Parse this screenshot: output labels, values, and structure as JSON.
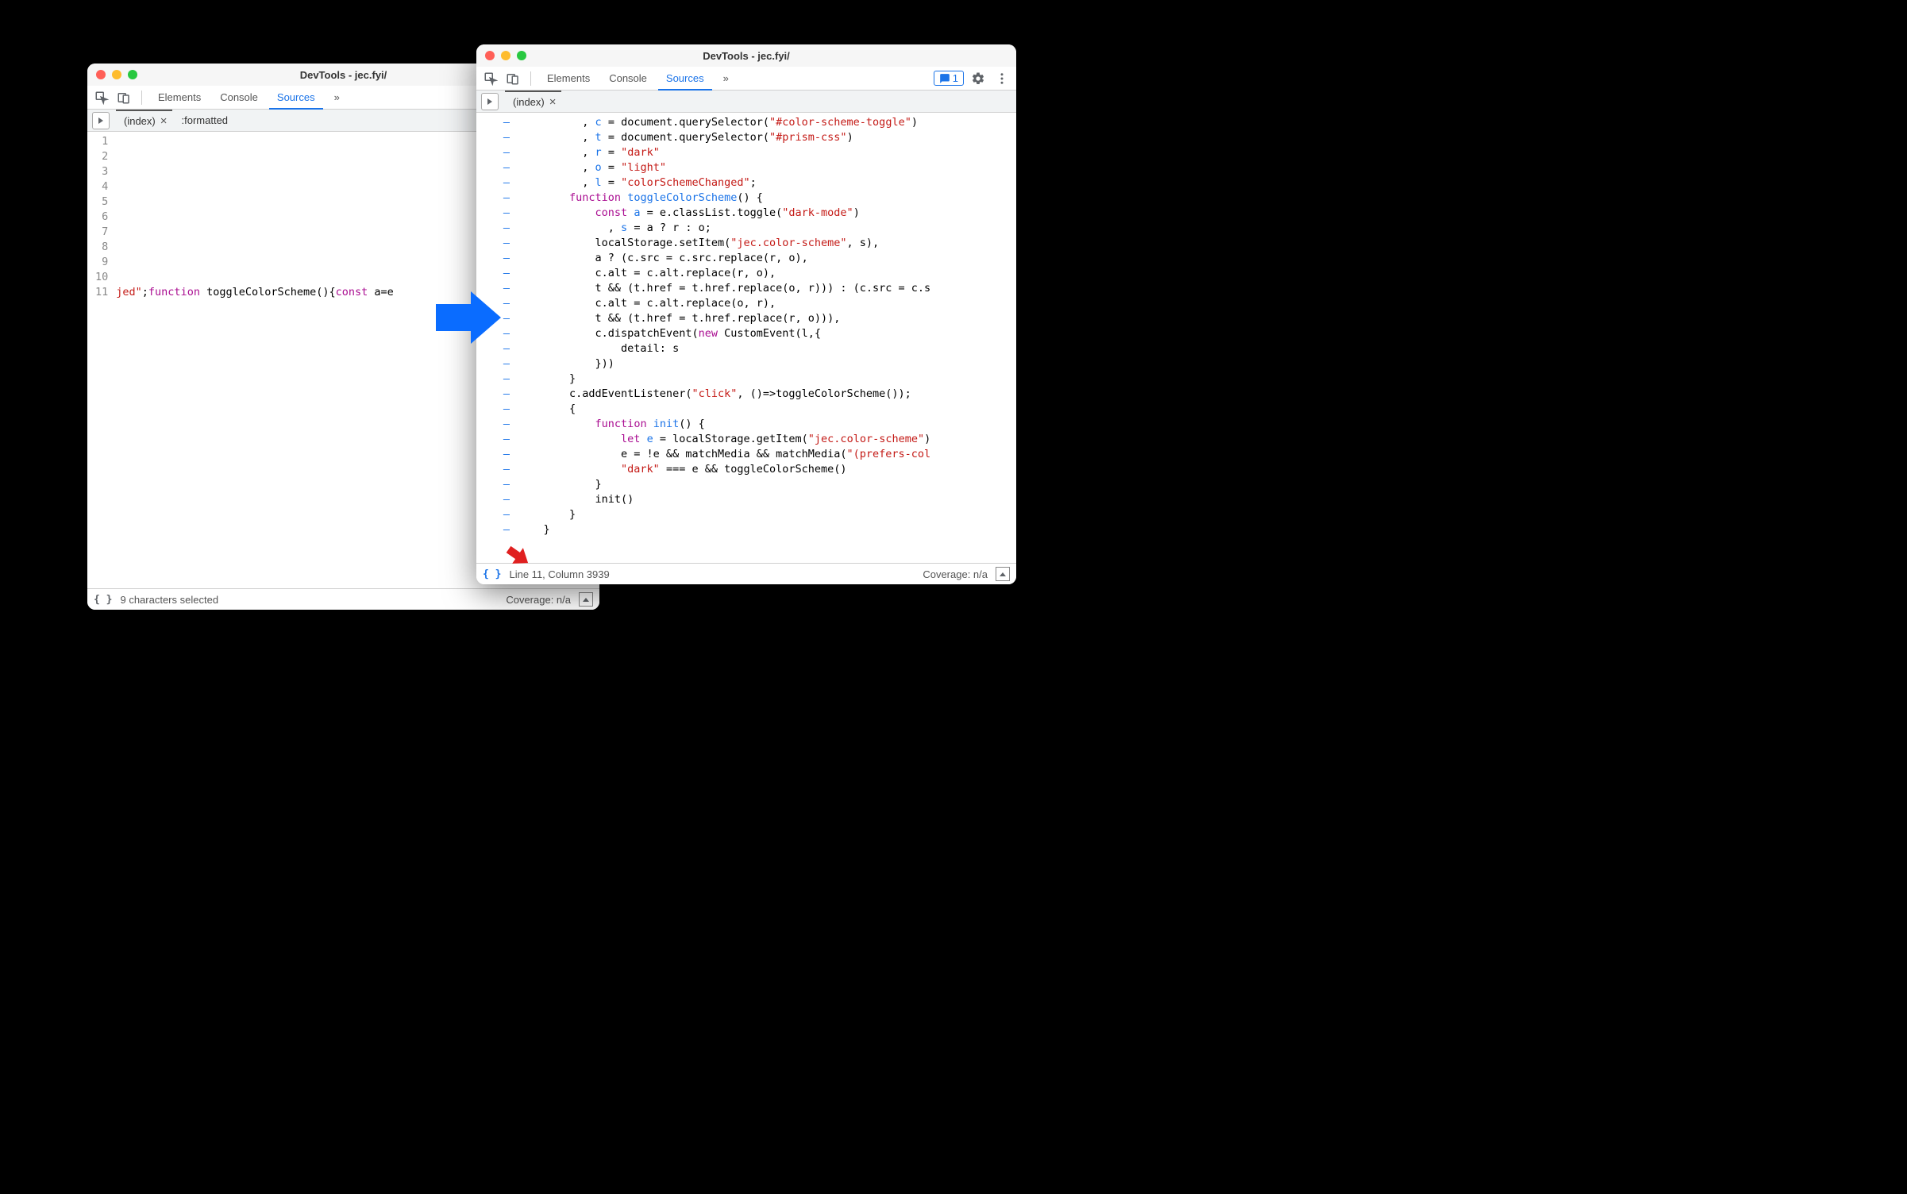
{
  "left": {
    "title": "DevTools - jec.fyi/",
    "tabs": [
      "Elements",
      "Console",
      "Sources"
    ],
    "active_tab": "Sources",
    "more": "»",
    "filetabs": {
      "index": "(index)",
      "formatted": ":formatted"
    },
    "line_numbers": [
      "1",
      "2",
      "3",
      "4",
      "5",
      "6",
      "7",
      "8",
      "9",
      "10",
      "11"
    ],
    "code": {
      "frag1": "jed\"",
      "frag2": ";",
      "kw_function": "function",
      "fn_name": " toggleColorScheme(){",
      "kw_const": "const",
      "frag3": " a=e"
    },
    "status": {
      "pp": "{ }",
      "selection": "9 characters selected",
      "coverage": "Coverage: n/a"
    }
  },
  "right": {
    "title": "DevTools - jec.fyi/",
    "tabs": [
      "Elements",
      "Console",
      "Sources"
    ],
    "active_tab": "Sources",
    "more": "»",
    "issues_count": "1",
    "filetabs": {
      "index": "(index)"
    },
    "code_lines": [
      [
        [
          " ",
          10
        ],
        {
          "t": "          , ",
          "c": ""
        },
        {
          "t": "c",
          "c": "var"
        },
        {
          "t": " = document.querySelector(",
          "c": ""
        },
        {
          "t": "\"#color-scheme-toggle\"",
          "c": "str"
        },
        {
          "t": ")",
          "c": ""
        }
      ],
      [
        [
          " ",
          10
        ],
        {
          "t": "          , ",
          "c": ""
        },
        {
          "t": "t",
          "c": "var"
        },
        {
          "t": " = document.querySelector(",
          "c": ""
        },
        {
          "t": "\"#prism-css\"",
          "c": "str"
        },
        {
          "t": ")",
          "c": ""
        }
      ],
      [
        [
          " ",
          10
        ],
        {
          "t": "          , ",
          "c": ""
        },
        {
          "t": "r",
          "c": "var"
        },
        {
          "t": " = ",
          "c": ""
        },
        {
          "t": "\"dark\"",
          "c": "str"
        }
      ],
      [
        [
          " ",
          10
        ],
        {
          "t": "          , ",
          "c": ""
        },
        {
          "t": "o",
          "c": "var"
        },
        {
          "t": " = ",
          "c": ""
        },
        {
          "t": "\"light\"",
          "c": "str"
        }
      ],
      [
        [
          " ",
          10
        ],
        {
          "t": "          , ",
          "c": ""
        },
        {
          "t": "l",
          "c": "var"
        },
        {
          "t": " = ",
          "c": ""
        },
        {
          "t": "\"colorSchemeChanged\"",
          "c": "str"
        },
        {
          "t": ";",
          "c": ""
        }
      ],
      [
        [
          " ",
          8
        ],
        {
          "t": "        ",
          "c": ""
        },
        {
          "t": "function",
          "c": "kw"
        },
        {
          "t": " ",
          "c": ""
        },
        {
          "t": "toggleColorScheme",
          "c": "var"
        },
        {
          "t": "() {",
          "c": ""
        }
      ],
      [
        [
          " ",
          12
        ],
        {
          "t": "            ",
          "c": ""
        },
        {
          "t": "const",
          "c": "kw"
        },
        {
          "t": " ",
          "c": ""
        },
        {
          "t": "a",
          "c": "var"
        },
        {
          "t": " = e.classList.toggle(",
          "c": ""
        },
        {
          "t": "\"dark-mode\"",
          "c": "str"
        },
        {
          "t": ")",
          "c": ""
        }
      ],
      [
        [
          " ",
          14
        ],
        {
          "t": "              , ",
          "c": ""
        },
        {
          "t": "s",
          "c": "var"
        },
        {
          "t": " = a ? r : o;",
          "c": ""
        }
      ],
      [
        [
          " ",
          12
        ],
        {
          "t": "            localStorage.setItem(",
          "c": ""
        },
        {
          "t": "\"jec.color-scheme\"",
          "c": "str"
        },
        {
          "t": ", s),",
          "c": ""
        }
      ],
      [
        [
          " ",
          12
        ],
        {
          "t": "            a ? (c.src = c.src.replace(r, o),",
          "c": ""
        }
      ],
      [
        [
          " ",
          12
        ],
        {
          "t": "            c.alt = c.alt.replace(r, o),",
          "c": ""
        }
      ],
      [
        [
          " ",
          12
        ],
        {
          "t": "            t && (t.href = t.href.replace(o, r))) : (c.src = c.s",
          "c": ""
        }
      ],
      [
        [
          " ",
          12
        ],
        {
          "t": "            c.alt = c.alt.replace(o, r),",
          "c": ""
        }
      ],
      [
        [
          " ",
          12
        ],
        {
          "t": "            t && (t.href = t.href.replace(r, o))),",
          "c": ""
        }
      ],
      [
        [
          " ",
          12
        ],
        {
          "t": "            c.dispatchEvent(",
          "c": ""
        },
        {
          "t": "new",
          "c": "kw"
        },
        {
          "t": " CustomEvent(l,{",
          "c": ""
        }
      ],
      [
        [
          " ",
          16
        ],
        {
          "t": "                detail: s",
          "c": ""
        }
      ],
      [
        [
          " ",
          12
        ],
        {
          "t": "            }))",
          "c": ""
        }
      ],
      [
        [
          " ",
          8
        ],
        {
          "t": "        }",
          "c": ""
        }
      ],
      [
        [
          " ",
          8
        ],
        {
          "t": "        c.addEventListener(",
          "c": ""
        },
        {
          "t": "\"click\"",
          "c": "str"
        },
        {
          "t": ", ()=>toggleColorScheme());",
          "c": ""
        }
      ],
      [
        [
          " ",
          8
        ],
        {
          "t": "        {",
          "c": ""
        }
      ],
      [
        [
          " ",
          12
        ],
        {
          "t": "            ",
          "c": ""
        },
        {
          "t": "function",
          "c": "kw"
        },
        {
          "t": " ",
          "c": ""
        },
        {
          "t": "init",
          "c": "var"
        },
        {
          "t": "() {",
          "c": ""
        }
      ],
      [
        [
          " ",
          16
        ],
        {
          "t": "                ",
          "c": ""
        },
        {
          "t": "let",
          "c": "kw"
        },
        {
          "t": " ",
          "c": ""
        },
        {
          "t": "e",
          "c": "var"
        },
        {
          "t": " = localStorage.getItem(",
          "c": ""
        },
        {
          "t": "\"jec.color-scheme\"",
          "c": "str"
        },
        {
          "t": ")",
          "c": ""
        }
      ],
      [
        [
          " ",
          16
        ],
        {
          "t": "                e = !e && matchMedia && matchMedia(",
          "c": ""
        },
        {
          "t": "\"(prefers-col",
          "c": "str"
        }
      ],
      [
        [
          " ",
          16
        ],
        {
          "t": "                ",
          "c": ""
        },
        {
          "t": "\"dark\"",
          "c": "str"
        },
        {
          "t": " === e && toggleColorScheme()",
          "c": ""
        }
      ],
      [
        [
          " ",
          12
        ],
        {
          "t": "            }",
          "c": ""
        }
      ],
      [
        [
          " ",
          12
        ],
        {
          "t": "            init()",
          "c": ""
        }
      ],
      [
        [
          " ",
          8
        ],
        {
          "t": "        }",
          "c": ""
        }
      ],
      [
        [
          " ",
          4
        ],
        {
          "t": "    }",
          "c": ""
        }
      ]
    ],
    "status": {
      "pp": "{ }",
      "cursor": "Line 11, Column 3939",
      "coverage": "Coverage: n/a"
    }
  }
}
